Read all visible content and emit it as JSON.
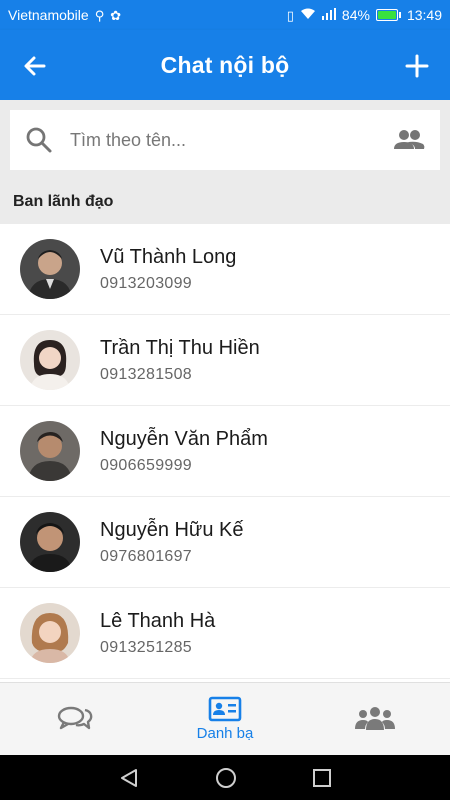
{
  "status_bar": {
    "carrier": "Vietnamobile",
    "battery": "84%",
    "time": "13:49",
    "battery_color": "#39e13f"
  },
  "app_bar": {
    "title": "Chat nội bộ",
    "back_icon": "arrow-left-icon",
    "add_icon": "plus-icon",
    "color": "#1780e8"
  },
  "search": {
    "placeholder": "Tìm theo tên...",
    "value": "",
    "icon": "search-icon",
    "group_icon": "group-icon"
  },
  "section": {
    "title": "Ban lãnh đạo"
  },
  "contacts": [
    {
      "name": "Vũ Thành Long",
      "phone": "0913203099"
    },
    {
      "name": "Trần Thị Thu Hiền",
      "phone": "0913281508"
    },
    {
      "name": "Nguyễn Văn Phẩm",
      "phone": "0906659999"
    },
    {
      "name": "Nguyễn Hữu Kế",
      "phone": "0976801697"
    },
    {
      "name": "Lê Thanh Hà",
      "phone": "0913251285"
    }
  ],
  "bottom_nav": {
    "items": [
      {
        "icon": "chat-icon",
        "label": "",
        "active": false
      },
      {
        "icon": "contact-card-icon",
        "label": "Danh bạ",
        "active": true
      },
      {
        "icon": "groups-icon",
        "label": "",
        "active": false
      }
    ]
  }
}
